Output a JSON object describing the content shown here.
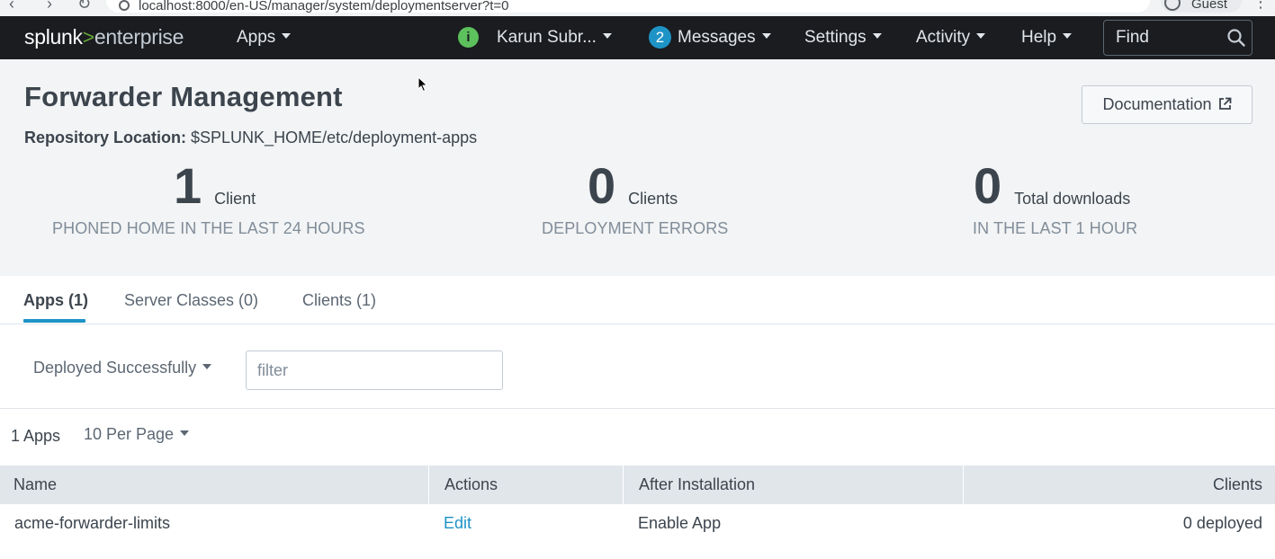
{
  "browser": {
    "url": "localhost:8000/en-US/manager/system/deploymentserver?t=0",
    "profile": "Guest"
  },
  "topnav": {
    "logo_main": "splunk",
    "logo_gt": ">",
    "logo_product": "enterprise",
    "apps": "Apps",
    "user": "Karun Subr...",
    "info_badge": "i",
    "messages_count": "2",
    "messages": "Messages",
    "settings": "Settings",
    "activity": "Activity",
    "help": "Help",
    "find_placeholder": "Find"
  },
  "header": {
    "title": "Forwarder Management",
    "repo_label": "Repository Location:",
    "repo_path": " $SPLUNK_HOME/etc/deployment-apps",
    "doc_button": "Documentation"
  },
  "stats": [
    {
      "value": "1",
      "unit": "Client",
      "sub": "PHONED HOME IN THE LAST 24 HOURS"
    },
    {
      "value": "0",
      "unit": "Clients",
      "sub": "DEPLOYMENT ERRORS"
    },
    {
      "value": "0",
      "unit": "Total downloads",
      "sub": "IN THE LAST 1 HOUR"
    }
  ],
  "tabs": [
    {
      "label": "Apps (1)",
      "active": true
    },
    {
      "label": "Server Classes (0)",
      "active": false
    },
    {
      "label": "Clients (1)",
      "active": false
    }
  ],
  "filter": {
    "status_selected": "Deployed Successfully",
    "placeholder": "filter",
    "value": ""
  },
  "paging": {
    "count": "1 Apps",
    "per_page": "10 Per Page"
  },
  "table": {
    "columns": [
      "Name",
      "Actions",
      "After Installation",
      "Clients"
    ],
    "rows": [
      {
        "name": "acme-forwarder-limits",
        "action": "Edit",
        "after_install": "Enable App",
        "clients": "0 deployed"
      }
    ]
  },
  "colors": {
    "nav_bg": "#1a1c20",
    "header_bg": "#f2f4f5",
    "accent": "#1e93c6",
    "logo_green": "#65a637",
    "info_green": "#5cc05c"
  }
}
